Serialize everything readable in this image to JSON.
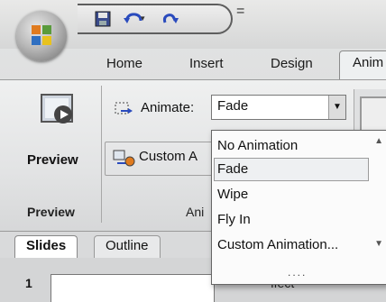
{
  "quick_access": {
    "save_icon": "save-icon",
    "undo_icon": "undo-icon",
    "redo_icon": "redo-icon",
    "more_label": "="
  },
  "tabs": [
    {
      "label": "Home"
    },
    {
      "label": "Insert"
    },
    {
      "label": "Design"
    },
    {
      "label": "Anim"
    }
  ],
  "ribbon": {
    "preview_button_label": "Preview",
    "preview_group_label": "Preview",
    "animate_label": "Animate:",
    "animate_value": "Fade",
    "custom_animation_label": "Custom A",
    "animations_group_label": "Ani"
  },
  "dropdown": {
    "items": [
      {
        "label": "No Animation"
      },
      {
        "label": "Fade"
      },
      {
        "label": "Wipe"
      },
      {
        "label": "Fly In"
      },
      {
        "label": "Custom Animation..."
      }
    ],
    "grip": "....",
    "selected_index": 1
  },
  "panes": {
    "slides_tab": "Slides",
    "outline_tab": "Outline"
  },
  "slide": {
    "number": "1",
    "partial_text": "ffect"
  },
  "colors": {
    "ribbon_bg": "#e2e3e4",
    "accent_orange": "#e07b1f"
  }
}
